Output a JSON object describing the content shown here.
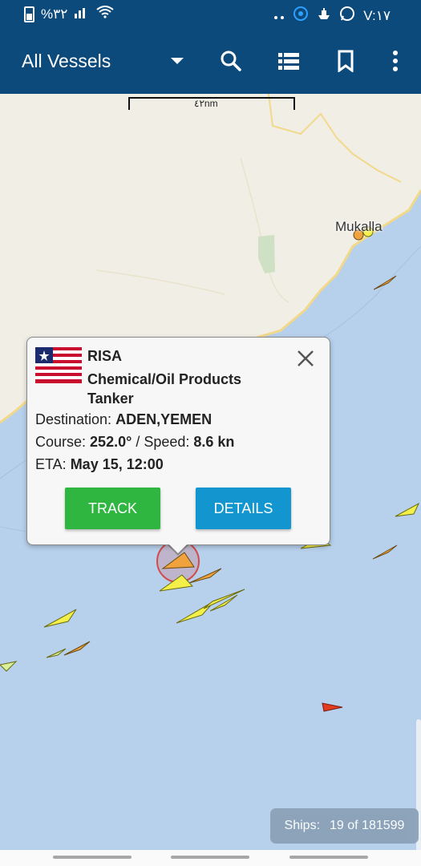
{
  "status_bar": {
    "left_text": "%٣٢",
    "time": "V:١٧"
  },
  "toolbar": {
    "title": "All Vessels",
    "icons": [
      "dropdown-caret-icon",
      "search-icon",
      "list-icon",
      "bookmark-icon",
      "more-vert-icon"
    ]
  },
  "map": {
    "scale_label": "٤٢nm",
    "city_label": "Mukalla",
    "colors": {
      "land": "#f1eee6",
      "sea": "#b7d0ec",
      "coast": "#f2d98a",
      "tanker": "#f0a33c",
      "cargo": "#f4f04a",
      "passenger": "#e23c1e"
    }
  },
  "vessel_popup": {
    "flag": "liberia-flag",
    "name": "RISA",
    "type": "Chemical/Oil Products Tanker",
    "destination_label": "Destination:",
    "destination": "ADEN,YEMEN",
    "course_label": "Course:",
    "course": "252.0°",
    "speed_label": "/ Speed:",
    "speed": "8.6 kn",
    "eta_label": "ETA:",
    "eta": "May 15, 12:00",
    "track_button": "TRACK",
    "details_button": "DETAILS"
  },
  "ships_counter": {
    "label": "Ships:",
    "value": "19 of 181599"
  }
}
